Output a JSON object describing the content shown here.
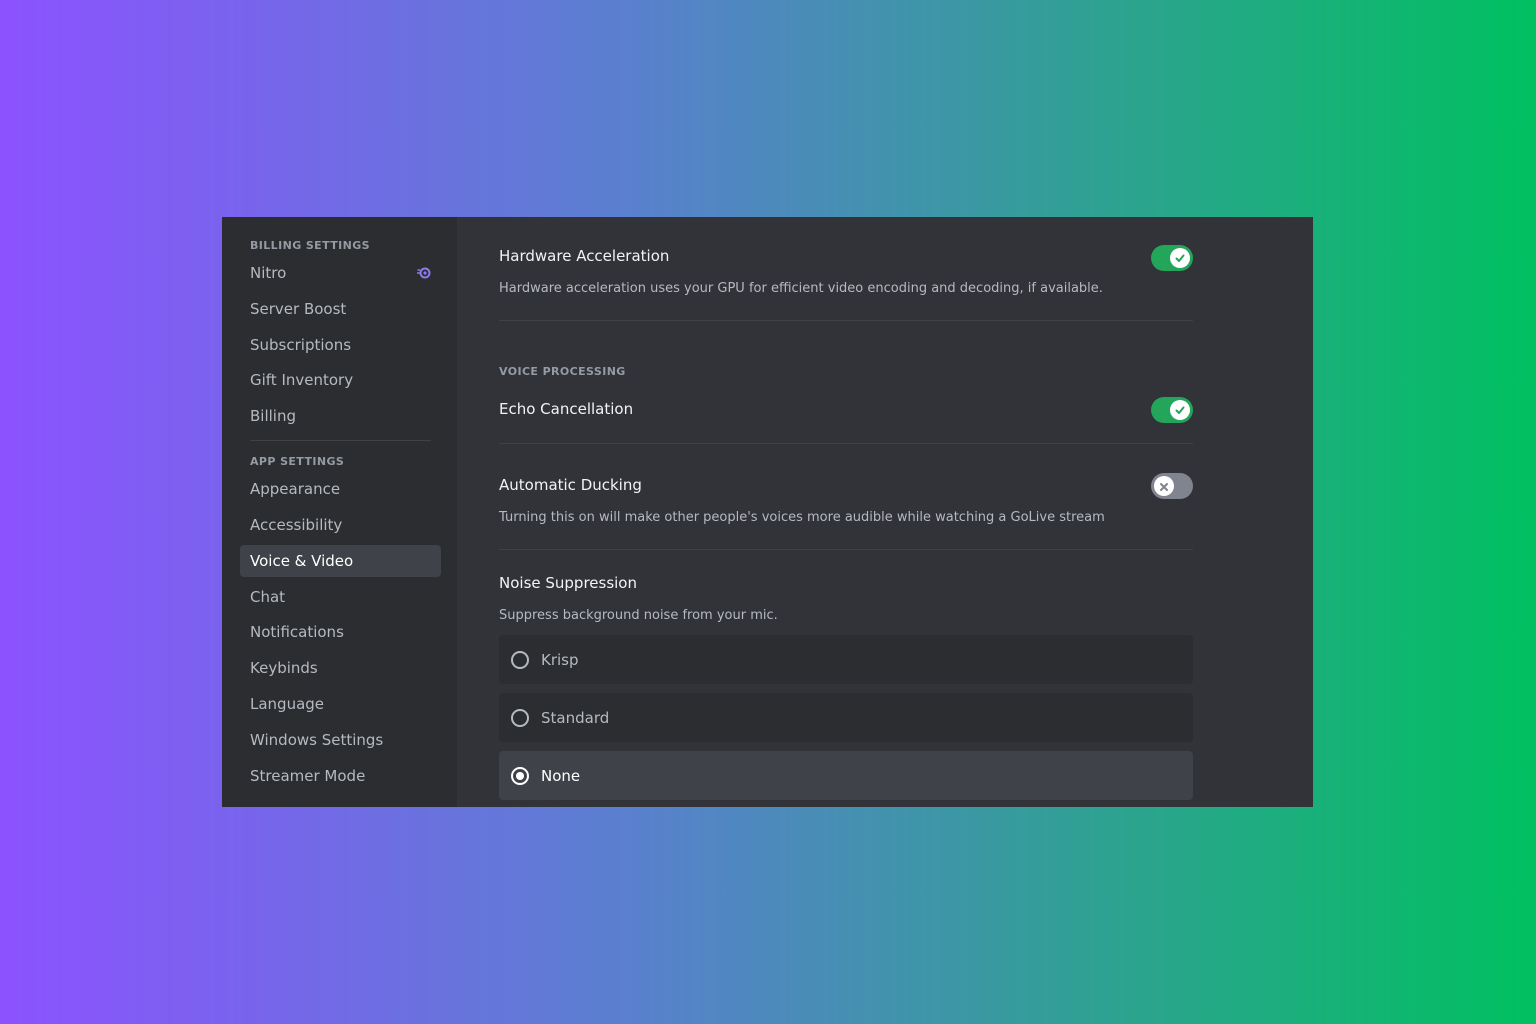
{
  "sidebar": {
    "billing_header": "BILLING SETTINGS",
    "billing_items": [
      {
        "label": "Nitro"
      },
      {
        "label": "Server Boost"
      },
      {
        "label": "Subscriptions"
      },
      {
        "label": "Gift Inventory"
      },
      {
        "label": "Billing"
      }
    ],
    "app_header": "APP SETTINGS",
    "app_items": [
      {
        "label": "Appearance"
      },
      {
        "label": "Accessibility"
      },
      {
        "label": "Voice & Video"
      },
      {
        "label": "Chat"
      },
      {
        "label": "Notifications"
      },
      {
        "label": "Keybinds"
      },
      {
        "label": "Language"
      },
      {
        "label": "Windows Settings"
      },
      {
        "label": "Streamer Mode"
      }
    ],
    "active_item": "Voice & Video",
    "nitro_icon": "nitro-icon"
  },
  "main": {
    "hardware_acceleration": {
      "title": "Hardware Acceleration",
      "description": "Hardware acceleration uses your GPU for efficient video encoding and decoding, if available.",
      "enabled": true
    },
    "voice_processing_header": "VOICE PROCESSING",
    "echo_cancellation": {
      "title": "Echo Cancellation",
      "enabled": true
    },
    "automatic_ducking": {
      "title": "Automatic Ducking",
      "description": "Turning this on will make other people's voices more audible while watching a GoLive stream",
      "enabled": false
    },
    "noise_suppression": {
      "title": "Noise Suppression",
      "description": "Suppress background noise from your mic.",
      "options": [
        {
          "label": "Krisp"
        },
        {
          "label": "Standard"
        },
        {
          "label": "None"
        }
      ],
      "selected": "None"
    }
  },
  "colors": {
    "toggle_on": "#23a55a",
    "toggle_off": "#80848e",
    "window_bg": "#313338",
    "sidebar_bg": "#2b2d31",
    "nitro_accent": "#8b7cf0"
  }
}
